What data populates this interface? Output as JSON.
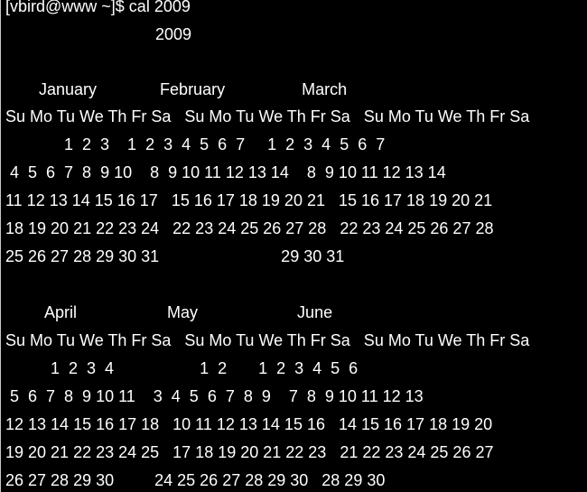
{
  "terminal": {
    "prompt": "[vbird@www ~]$ cal 2009",
    "year": "2009",
    "q1": {
      "month_names": "January              February                 March",
      "weekdays": "Su Mo Tu We Th Fr Sa   Su Mo Tu We Th Fr Sa   Su Mo Tu We Th Fr Sa",
      "rows": [
        "             1  2  3    1  2  3  4  5  6  7     1  2  3  4  5  6  7",
        " 4  5  6  7  8  9 10    8  9 10 11 12 13 14    8  9 10 11 12 13 14",
        "11 12 13 14 15 16 17   15 16 17 18 19 20 21   15 16 17 18 19 20 21",
        "18 19 20 21 22 23 24   22 23 24 25 26 27 28   22 23 24 25 26 27 28",
        "25 26 27 28 29 30 31                           29 30 31"
      ]
    },
    "q2": {
      "month_names": "April                    May                      June",
      "weekdays": "Su Mo Tu We Th Fr Sa   Su Mo Tu We Th Fr Sa   Su Mo Tu We Th Fr Sa",
      "rows": [
        "          1  2  3  4                   1  2       1  2  3  4  5  6",
        " 5  6  7  8  9 10 11    3  4  5  6  7  8  9    7  8  9 10 11 12 13",
        "12 13 14 15 16 17 18   10 11 12 13 14 15 16   14 15 16 17 18 19 20",
        "19 20 21 22 23 24 25   17 18 19 20 21 22 23   21 22 23 24 25 26 27",
        "26 27 28 29 30         24 25 26 27 28 29 30   28 29 30"
      ]
    }
  }
}
